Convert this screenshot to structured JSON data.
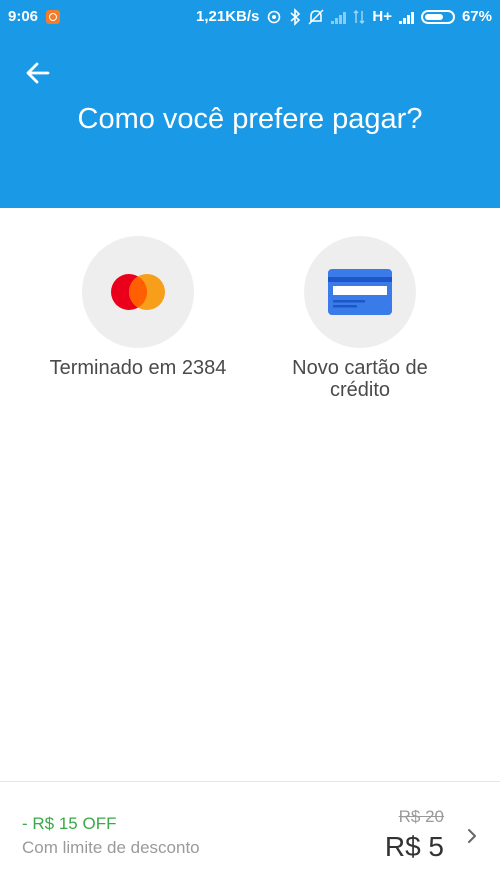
{
  "status_bar": {
    "time": "9:06",
    "network_speed": "1,21KB/s",
    "network_type": "H+",
    "battery": "67%",
    "icons": [
      "app-notification-icon",
      "sync-icon",
      "bluetooth-icon",
      "mute-icon",
      "signal-icon",
      "data-arrows-icon",
      "signal-icon",
      "battery-icon"
    ]
  },
  "header": {
    "title": "Como você prefere pagar?",
    "back_icon": "back-arrow-icon",
    "background_color": "#1999e6"
  },
  "payment_options": [
    {
      "label": "Terminado em 2384",
      "icon": "mastercard-icon"
    },
    {
      "label": "Novo cartão de crédito",
      "icon": "credit-card-icon"
    }
  ],
  "footer": {
    "discount": "- R$ 15 OFF",
    "discount_note": "Com limite de desconto",
    "original_price": "R$ 20",
    "final_price": "R$ 5",
    "discount_color": "#3aa94a"
  }
}
